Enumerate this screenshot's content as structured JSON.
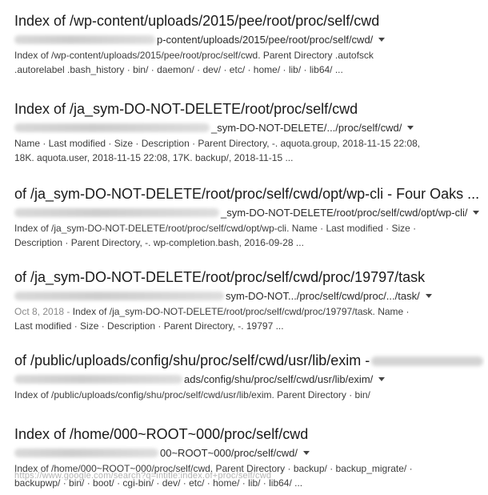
{
  "results": [
    {
      "title": "Index of /wp-content/uploads/2015/pee/root/proc/self/cwd",
      "url_path": "p-content/uploads/2015/pee/root/proc/self/cwd/",
      "snippet_lines": [
        "Index of /wp-content/uploads/2015/pee/root/proc/self/cwd. Parent Directory .autofsck",
        ".autorelabel .bash_history · bin/ · daemon/ · dev/ · etc/ · home/ · lib/ · lib64/ ..."
      ]
    },
    {
      "title": "Index of /ja_sym-DO-NOT-DELETE/root/proc/self/cwd",
      "url_path": "_sym-DO-NOT-DELETE/.../proc/self/cwd/",
      "snippet_lines": [
        "Name · Last modified · Size · Description · Parent Directory, -. aquota.group, 2018-11-15 22:08,",
        "18K. aquota.user, 2018-11-15 22:08, 17K. backup/, 2018-11-15 ..."
      ]
    },
    {
      "title": "of /ja_sym-DO-NOT-DELETE/root/proc/self/cwd/opt/wp-cli - Four Oaks ...",
      "url_path": "_sym-DO-NOT-DELETE/root/proc/self/cwd/opt/wp-cli/",
      "snippet_lines": [
        "Index of /ja_sym-DO-NOT-DELETE/root/proc/self/cwd/opt/wp-cli. Name · Last modified · Size ·",
        "Description · Parent Directory, -. wp-completion.bash, 2016-09-28 ..."
      ]
    },
    {
      "title": "of /ja_sym-DO-NOT-DELETE/root/proc/self/cwd/proc/19797/task",
      "url_path": "sym-DO-NOT.../proc/self/cwd/proc/.../task/",
      "snippet_date": "Oct 8, 2018 -",
      "snippet_lines": [
        "Index of /ja_sym-DO-NOT-DELETE/root/proc/self/cwd/proc/19797/task. Name ·",
        "Last modified · Size · Description · Parent Directory, -. 19797 ..."
      ]
    },
    {
      "title": "of /public/uploads/config/shu/proc/self/cwd/usr/lib/exim -",
      "url_path": "ads/config/shu/proc/self/cwd/usr/lib/exim/",
      "snippet_lines": [
        "Index of /public/uploads/config/shu/proc/self/cwd/usr/lib/exim. Parent Directory · bin/"
      ]
    },
    {
      "title": "Index of /home/000~ROOT~000/proc/self/cwd",
      "url_path": "00~ROOT~000/proc/self/cwd/",
      "snippet_lines": [
        "Index of /home/000~ROOT~000/proc/self/cwd. Parent Directory · backup/ · backup_migrate/ ·",
        "backupwp/ · bin/ · boot/ · cgi-bin/ · dev/ · etc/ · home/ · lib/ · lib64/ ..."
      ]
    }
  ],
  "watermark": "https://www.google.com/search?q=intitle:index.of+proc/self/cwd"
}
